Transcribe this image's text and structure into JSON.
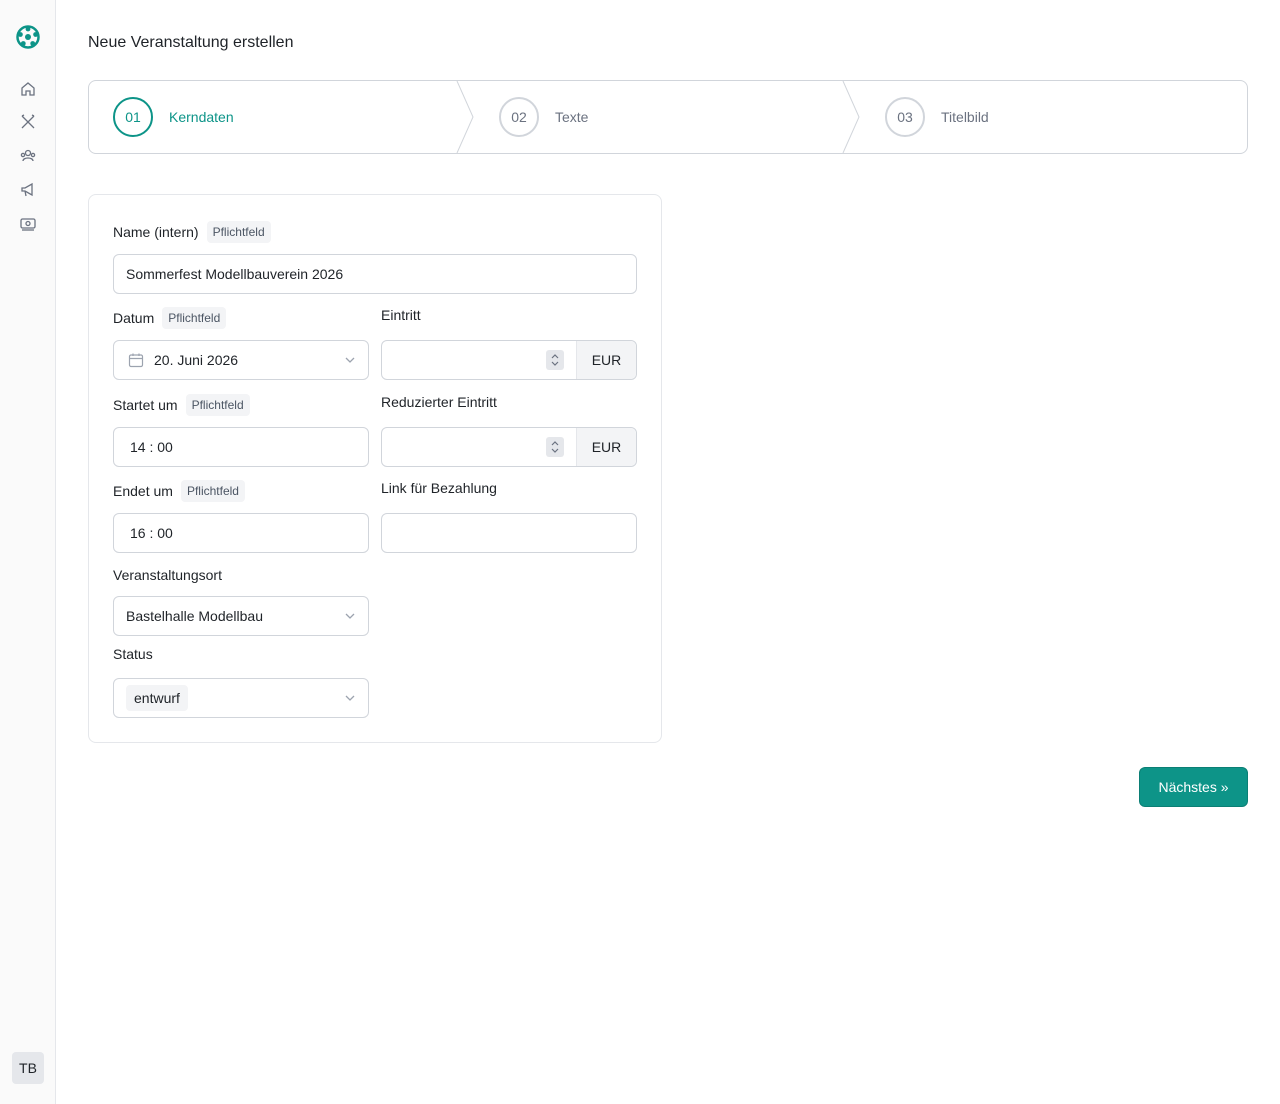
{
  "app": {
    "title": "Neue Veranstaltung erstellen",
    "user_initials": "TB"
  },
  "sidebar": {
    "icons": [
      "home-icon",
      "tools-icon",
      "people-icon",
      "megaphone-icon",
      "money-icon"
    ]
  },
  "steps": [
    {
      "number": "01",
      "label": "Kerndaten",
      "active": true
    },
    {
      "number": "02",
      "label": "Texte",
      "active": false
    },
    {
      "number": "03",
      "label": "Titelbild",
      "active": false
    }
  ],
  "form": {
    "required_badge": "Pflichtfeld",
    "name": {
      "label": "Name (intern)",
      "value": "Sommerfest Modellbauverein 2026"
    },
    "date": {
      "label": "Datum",
      "value": "20. Juni 2026"
    },
    "entry": {
      "label": "Eintritt",
      "value": "",
      "currency": "EUR"
    },
    "start": {
      "label": "Startet um",
      "value": "14 : 00"
    },
    "reduced_entry": {
      "label": "Reduzierter Eintritt",
      "value": "",
      "currency": "EUR"
    },
    "end": {
      "label": "Endet um",
      "value": "16 : 00"
    },
    "payment_link": {
      "label": "Link für Bezahlung",
      "value": ""
    },
    "venue": {
      "label": "Veranstaltungsort",
      "value": "Bastelhalle Modellbau"
    },
    "status": {
      "label": "Status",
      "value": "entwurf"
    }
  },
  "actions": {
    "next_label": "Nächstes »"
  },
  "colors": {
    "accent": "#0d9488"
  }
}
